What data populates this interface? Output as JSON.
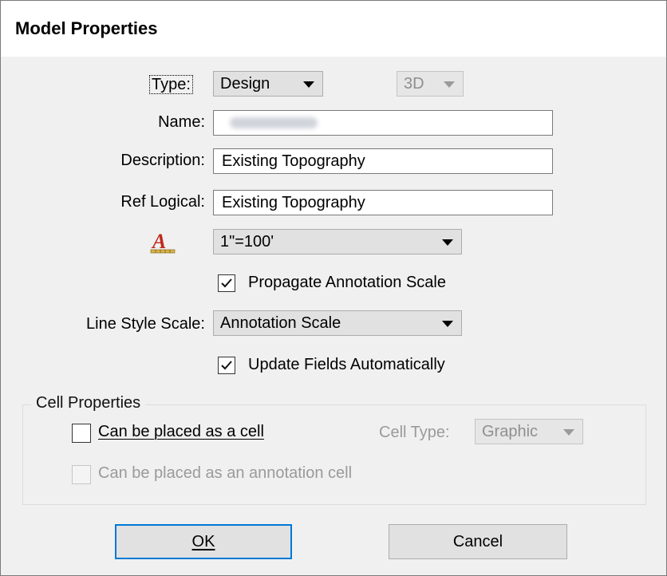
{
  "dialog": {
    "title": "Model Properties"
  },
  "form": {
    "type_label": "Type:",
    "type_value": "Design",
    "dimension_value": "3D",
    "name_label": "Name:",
    "name_value": "",
    "description_label": "Description:",
    "description_value": "Existing Topography",
    "ref_logical_label": "Ref Logical:",
    "ref_logical_value": "Existing Topography",
    "annotation_scale_value": "1\"=100'",
    "propagate_label": "Propagate Annotation Scale",
    "propagate_checked": true,
    "line_style_scale_label": "Line Style Scale:",
    "line_style_scale_value": "Annotation Scale",
    "update_fields_label": "Update Fields Automatically",
    "update_fields_checked": true
  },
  "cell_properties": {
    "group_label": "Cell Properties",
    "placed_as_cell_label": "Can be placed as a cell",
    "placed_as_cell_checked": false,
    "cell_type_label": "Cell Type:",
    "cell_type_value": "Graphic",
    "annotation_cell_label": "Can be placed as an annotation cell",
    "annotation_cell_checked": false
  },
  "buttons": {
    "ok_label": "OK",
    "cancel_label": "Cancel"
  },
  "colors": {
    "accent": "#0078d7",
    "annotation_icon": "#c0281c"
  },
  "icons": {
    "annotation_scale": "annotation-scale-icon"
  }
}
